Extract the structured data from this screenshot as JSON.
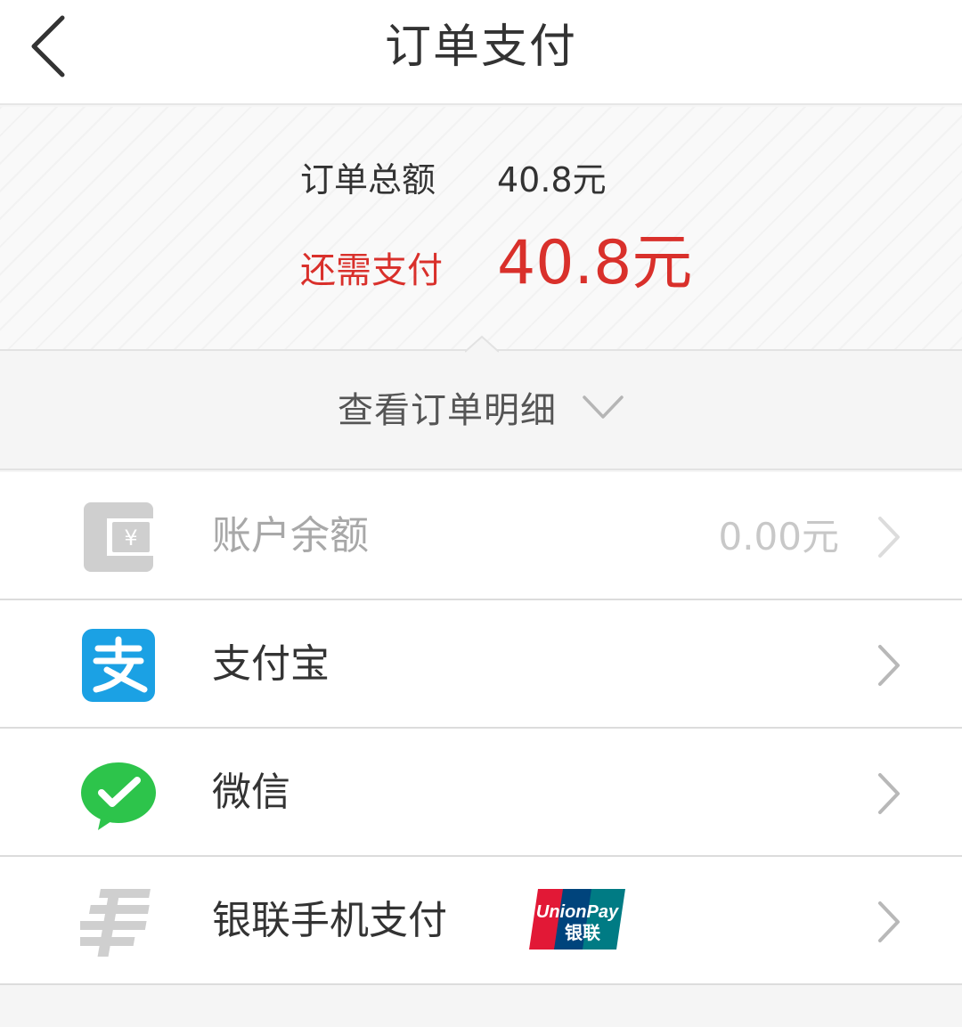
{
  "header": {
    "title": "订单支付",
    "back_icon": "chevron-left-icon"
  },
  "summary": {
    "total_label": "订单总额",
    "total_value": "40.8元",
    "due_label": "还需支付",
    "due_value": "40.8元",
    "accent_color": "#d9302b"
  },
  "detail_toggle": {
    "label": "查看订单明细",
    "icon": "chevron-down-icon"
  },
  "payment_methods": [
    {
      "label": "账户余额",
      "amount": "0.00元",
      "icon": "wallet-icon",
      "enabled": false
    },
    {
      "label": "支付宝",
      "icon": "alipay-icon",
      "color": "#1ba1e4"
    },
    {
      "label": "微信",
      "icon": "wechat-pay-icon",
      "color": "#2dc44b"
    },
    {
      "label": "银联手机支付",
      "icon": "unionpay-icon",
      "badge": "unionpay-logo",
      "badge_text": "UnionPay 银联"
    }
  ]
}
